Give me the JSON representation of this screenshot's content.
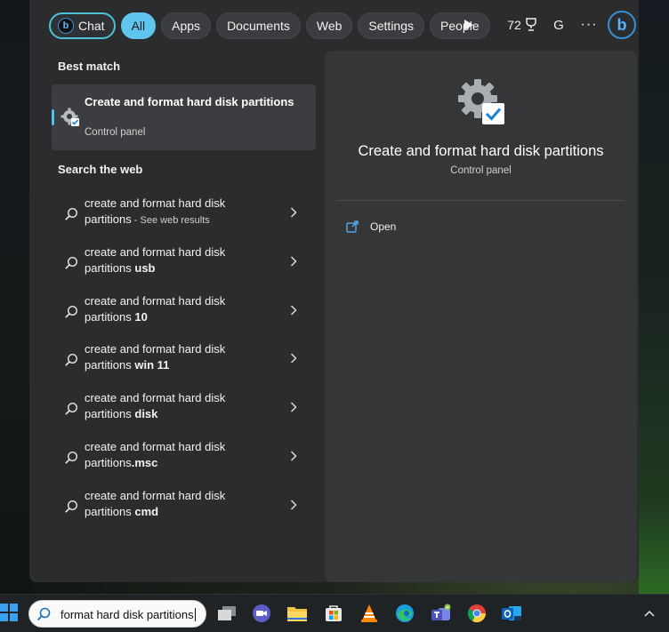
{
  "filters": {
    "chat": "Chat",
    "all": "All",
    "apps": "Apps",
    "documents": "Documents",
    "web": "Web",
    "settings": "Settings",
    "people": "People",
    "points": "72",
    "account_initial": "G",
    "more": "···"
  },
  "best_match": {
    "heading": "Best match",
    "title": "Create and format hard disk partitions",
    "subtitle": "Control panel"
  },
  "web_search": {
    "heading": "Search the web",
    "items": [
      {
        "prefix": "create and format hard disk",
        "line2": "partitions",
        "suffix": "",
        "note": " - See web results"
      },
      {
        "prefix": "create and format hard disk",
        "line2": "partitions ",
        "suffix": "usb",
        "note": ""
      },
      {
        "prefix": "create and format hard disk",
        "line2": "partitions ",
        "suffix": "10",
        "note": ""
      },
      {
        "prefix": "create and format hard disk",
        "line2": "partitions ",
        "suffix": "win 11",
        "note": ""
      },
      {
        "prefix": "create and format hard disk",
        "line2": "partitions ",
        "suffix": "disk",
        "note": ""
      },
      {
        "prefix": "create and format hard disk",
        "line2": "partitions",
        "suffix": ".msc",
        "note": ""
      },
      {
        "prefix": "create and format hard disk",
        "line2": "partitions ",
        "suffix": "cmd",
        "note": ""
      }
    ]
  },
  "preview": {
    "title": "Create and format hard disk partitions",
    "subtitle": "Control panel",
    "open_label": "Open"
  },
  "taskbar": {
    "search_value": "format hard disk partitions",
    "apps": [
      "task-view",
      "meet-now",
      "file-explorer",
      "microsoft-store",
      "vlc",
      "edge",
      "teams",
      "chrome",
      "outlook"
    ]
  },
  "colors": {
    "accent": "#4cc2f1",
    "active_pill": "#5fc4ee",
    "panel_bg": "#2a2c2e",
    "preview_bg": "#343638"
  }
}
